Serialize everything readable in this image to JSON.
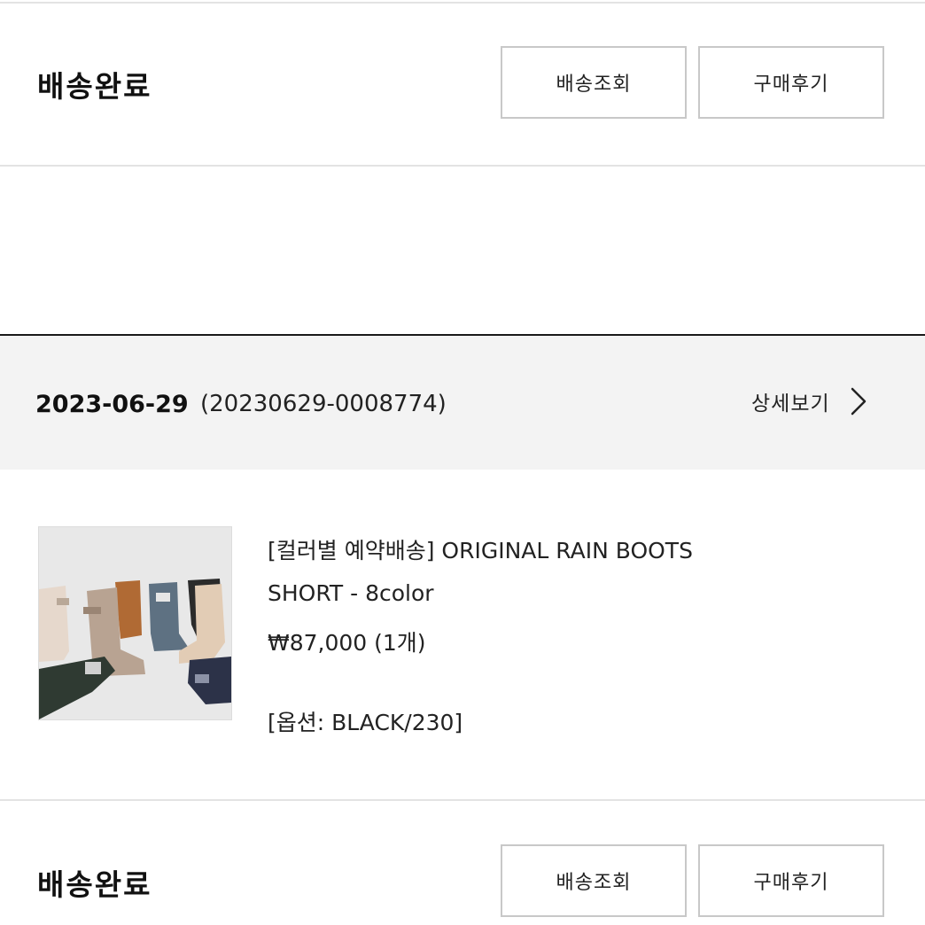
{
  "sections": {
    "top": {
      "status": "배송완료",
      "track_label": "배송조회",
      "review_label": "구매후기"
    },
    "bottom": {
      "status": "배송완료",
      "track_label": "배송조회",
      "review_label": "구매후기"
    }
  },
  "order": {
    "date": "2023-06-29",
    "number": "(20230629-0008774)",
    "detail_label": "상세보기",
    "chevron_icon": "chevron-right-icon"
  },
  "product": {
    "image_icon": "rain-boots-photo",
    "name_line1": "[컬러별 예약배송] ORIGINAL RAIN BOOTS",
    "name_line2": "SHORT - 8color",
    "price": "₩87,000 (1개)",
    "option": "[옵션: BLACK/230]"
  },
  "colors": {
    "divider": "#e3e3e3",
    "header_bg": "#f3f3f3",
    "header_border": "#1a1a1a",
    "button_border": "#c8c8c8"
  }
}
